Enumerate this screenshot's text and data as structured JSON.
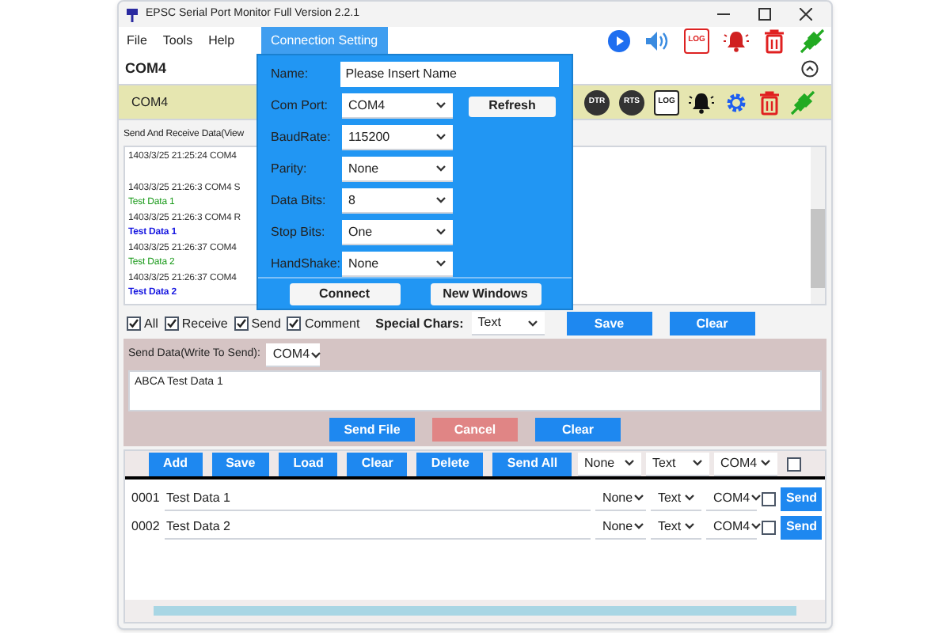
{
  "window": {
    "title": "EPSC Serial Port Monitor Full Version 2.2.1"
  },
  "menu": [
    {
      "label": "File",
      "selected": false
    },
    {
      "label": "Tools",
      "selected": false
    },
    {
      "label": "Help",
      "selected": false
    },
    {
      "label": "Connection Setting",
      "selected": true
    }
  ],
  "port_header": {
    "label": "COM4"
  },
  "port_bar": {
    "label": "COM4",
    "badges": [
      "DTR",
      "RTS"
    ],
    "log_label": "LOG"
  },
  "toolbar": {
    "log_label": "LOG"
  },
  "view": {
    "title": "Send And Receive Data(View",
    "log": [
      {
        "kind": "meta",
        "text": "1403/3/25 21:25:24 COM4"
      },
      {
        "kind": "meta",
        "text": "1403/3/25 21:26:3 COM4 S"
      },
      {
        "kind": "send",
        "text": "Test Data 1"
      },
      {
        "kind": "meta",
        "text": "1403/3/25 21:26:3 COM4 R"
      },
      {
        "kind": "receive",
        "text": "Test Data 1"
      },
      {
        "kind": "meta",
        "text": "1403/3/25 21:26:37 COM4"
      },
      {
        "kind": "send",
        "text": "Test Data 2"
      },
      {
        "kind": "meta",
        "text": "1403/3/25 21:26:37 COM4"
      },
      {
        "kind": "receive",
        "text": "Test Data 2"
      }
    ],
    "filters": [
      {
        "label": "All",
        "checked": true
      },
      {
        "label": "Receive",
        "checked": true
      },
      {
        "label": "Send",
        "checked": true
      },
      {
        "label": "Comment",
        "checked": true
      }
    ],
    "special_chars": {
      "label": "Special Chars:",
      "value": "Text"
    },
    "buttons": [
      "Save",
      "Clear"
    ]
  },
  "send": {
    "label": "Send Data(Write To Send):",
    "port": "COM4",
    "text": "ABCA Test Data 1",
    "buttons": [
      {
        "label": "Send File",
        "disabled": false
      },
      {
        "label": "Cancel",
        "disabled": true
      },
      {
        "label": "Clear",
        "disabled": false
      }
    ]
  },
  "list": {
    "buttons": [
      "Add",
      "Save",
      "Load",
      "Clear",
      "Delete",
      "Send All"
    ],
    "selects": [
      "None",
      "Text",
      "COM4"
    ],
    "select_all": false,
    "rows": [
      {
        "index": "0001",
        "text": "Test Data 1",
        "selects": [
          "None",
          "Text",
          "COM4"
        ],
        "checked": false,
        "send": "Send"
      },
      {
        "index": "0002",
        "text": "Test Data 2",
        "selects": [
          "None",
          "Text",
          "COM4"
        ],
        "checked": false,
        "send": "Send"
      }
    ]
  },
  "dialog": {
    "fields": [
      {
        "kind": "input",
        "label": "Name:",
        "value": "Please Insert Name"
      },
      {
        "kind": "select",
        "label": "Com Port:",
        "value": "COM4"
      },
      {
        "kind": "select",
        "label": "BaudRate:",
        "value": "115200"
      },
      {
        "kind": "select",
        "label": "Parity:",
        "value": "None"
      },
      {
        "kind": "select",
        "label": "Data Bits:",
        "value": "8"
      },
      {
        "kind": "select",
        "label": "Stop Bits:",
        "value": "One"
      },
      {
        "kind": "select",
        "label": "HandShake:",
        "value": "None"
      }
    ],
    "refresh": "Refresh",
    "buttons": [
      "Connect",
      "New Windows"
    ]
  }
}
